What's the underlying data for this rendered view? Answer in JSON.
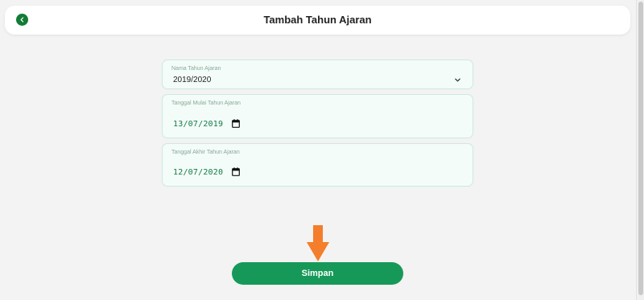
{
  "header": {
    "title": "Tambah Tahun Ajaran",
    "back_icon": "chevron-left-icon"
  },
  "form": {
    "academic_year": {
      "label": "Nama Tahun Ajaran",
      "value": "2019/2020",
      "icon": "chevron-down-icon"
    },
    "start_date": {
      "label": "Tanggal Mulai Tahun Ajaran",
      "value": "13/07/2019",
      "icon": "calendar-icon"
    },
    "end_date": {
      "label": "Tanggal Akhir Tahun Ajaran",
      "value": "12/07/2020",
      "icon": "calendar-icon"
    },
    "submit_label": "Simpan"
  },
  "annotation": {
    "icon": "arrow-down-icon",
    "color": "#f47e2b"
  },
  "colors": {
    "primary": "#169958",
    "back_button": "#137b35",
    "date_text": "#137b45",
    "field_bg": "#f3fcf8",
    "field_border": "#cfe9dc"
  }
}
